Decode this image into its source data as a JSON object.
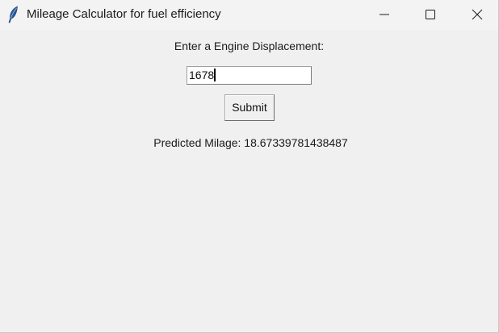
{
  "window": {
    "title": "Mileage Calculator for fuel efficiency",
    "app_icon": "feather-icon",
    "controls": {
      "minimize_icon": "minimize-icon",
      "maximize_icon": "maximize-icon",
      "close_icon": "close-icon"
    }
  },
  "form": {
    "prompt_label": "Enter a Engine Displacement:",
    "displacement_value": "1678",
    "submit_label": "Submit",
    "result_text": "Predicted Milage: 18.67339781438487"
  },
  "colors": {
    "background": "#f0f0f0",
    "titlebar": "#f3f3f3",
    "entry_background": "#ffffff",
    "text": "#1a1a1a"
  }
}
